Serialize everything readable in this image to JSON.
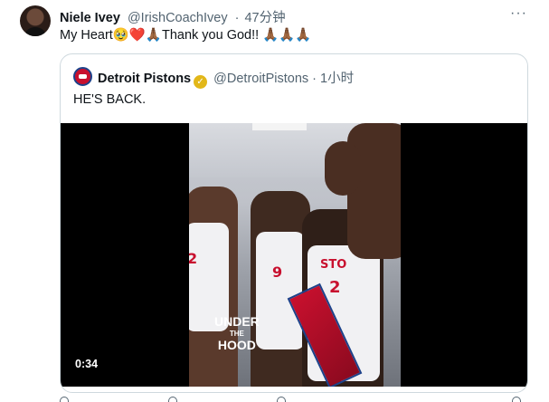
{
  "author": {
    "name": "Niele Ivey",
    "handle": "@IrishCoachIvey",
    "separator": "·",
    "time": "47分钟"
  },
  "tweet": {
    "text": "My Heart🥹❤️🙏🏾Thank you God!! 🙏🏾🙏🏾🙏🏾"
  },
  "quoted": {
    "name": "Detroit Pistons",
    "handle": "@DetroitPistons",
    "separator": "·",
    "time": "1小时",
    "text": "HE'S BACK.",
    "video": {
      "duration": "0:34",
      "watermark_line1": "UNDER",
      "watermark_line2": "THE",
      "watermark_line3": "HOOD"
    }
  },
  "colors": {
    "text": "#0f1419",
    "muted": "#536471",
    "border": "#cfd9de",
    "pistons_red": "#c8102e",
    "pistons_blue": "#1d428a",
    "verified_gold": "#e2b719"
  },
  "icons": [
    "more-options-icon",
    "verified-badge-icon",
    "reply-icon",
    "retweet-icon",
    "like-icon",
    "share-icon"
  ]
}
